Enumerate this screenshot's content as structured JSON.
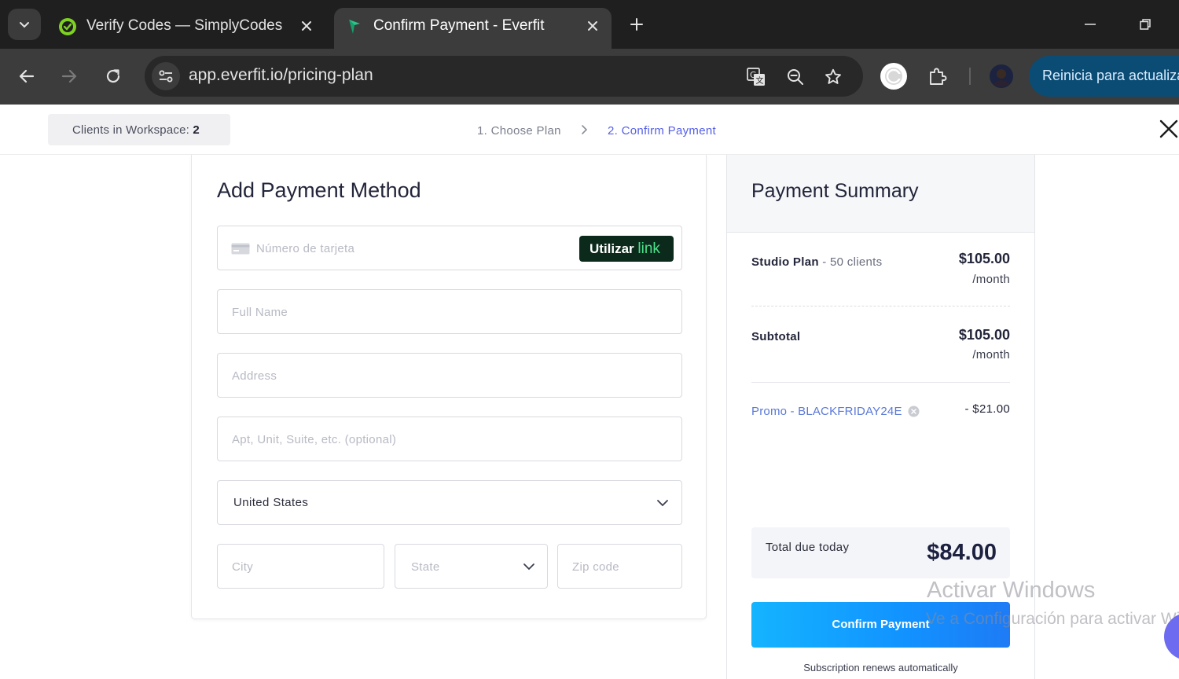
{
  "browser": {
    "tabs": [
      {
        "title": "Verify Codes — SimplyCodes",
        "active": false
      },
      {
        "title": "Confirm Payment - Everfit",
        "active": true
      }
    ],
    "url": "app.everfit.io/pricing-plan",
    "restart_label": "Reinicia para actualizar",
    "accent_color": "#0b4c74"
  },
  "header": {
    "workspace_label": "Clients in Workspace: ",
    "workspace_count": "2",
    "steps": [
      "1. Choose Plan",
      "2. Confirm Payment"
    ],
    "active_step_color": "#5560e6"
  },
  "payment_form": {
    "title": "Add Payment Method",
    "card_number_placeholder": "Número de tarjeta",
    "link_button": {
      "prefix": "Utilizar",
      "suffix": "link"
    },
    "full_name_placeholder": "Full Name",
    "address_placeholder": "Address",
    "apt_placeholder": "Apt, Unit, Suite, etc. (optional)",
    "country_value": "United States",
    "city_placeholder": "City",
    "state_placeholder": "State",
    "zip_placeholder": "Zip code"
  },
  "summary": {
    "title": "Payment Summary",
    "plan_name": "Studio Plan",
    "plan_detail": " - 50 clients",
    "plan_amount": "$105.00",
    "plan_period": "/month",
    "subtotal_label": "Subtotal",
    "subtotal_amount": "$105.00",
    "subtotal_period": "/month",
    "promo_label": "Promo - BLACKFRIDAY24E",
    "promo_discount": "- $21.00",
    "total_label": "Total due today",
    "total_amount": "$84.00",
    "confirm_label": "Confirm Payment",
    "renew_note": "Subscription renews automatically"
  },
  "watermark": {
    "line1": "Activar Windows",
    "line2": "Ve a Configuración para activar Windows."
  }
}
